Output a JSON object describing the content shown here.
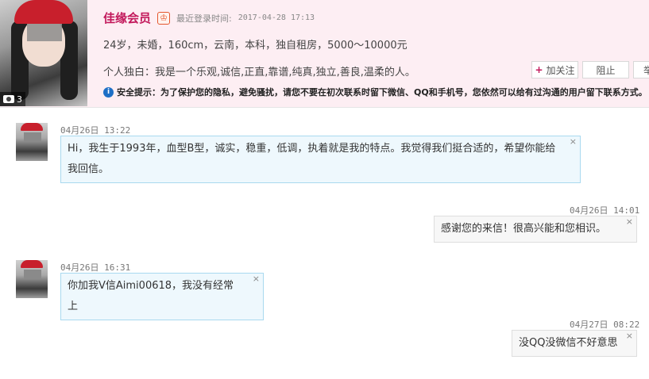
{
  "profile": {
    "name": "佳缘会员",
    "vip_badge": "♔",
    "login_label": "最近登录时间:",
    "login_time": "2017-04-28 17:13",
    "basic_info": "24岁，未婚，160cm，云南，本科，独自租房，5000～10000元",
    "monologue": "个人独白：我是一个乐观,诚信,正直,靠谱,纯真,独立,善良,温柔的人。",
    "photo_count": "3",
    "follow_label": "加关注",
    "block_label": "阻止",
    "more_label": "举",
    "security_tip": "安全提示：为了保护您的隐私，避免骚扰，请您不要在初次联系时留下微信、QQ和手机号，您依然可以给有过沟通的用户留下联系方式。",
    "info_icon_glyph": "i"
  },
  "messages": [
    {
      "direction": "in",
      "date": "04月26日",
      "time": "13:22",
      "text": "Hi，我生于1993年，血型B型，诚实，稳重，低调，执着就是我的特点。我觉得我们挺合适的，希望你能给我回信。"
    },
    {
      "direction": "out",
      "date": "04月26日",
      "time": "14:01",
      "text": "感谢您的来信！很高兴能和您相识。"
    },
    {
      "direction": "in",
      "date": "04月26日",
      "time": "16:31",
      "text": "你加我V信Aimi00618，我没有经常上"
    },
    {
      "direction": "out",
      "date": "04月27日",
      "time": "08:22",
      "text": "没QQ没微信不好意思"
    }
  ],
  "close_glyph": "×",
  "colors": {
    "accent": "#c2185b",
    "header_bg": "#fdeef3",
    "bubble_in_border": "#a9d9ef",
    "bubble_in_bg": "#eef8fd"
  }
}
